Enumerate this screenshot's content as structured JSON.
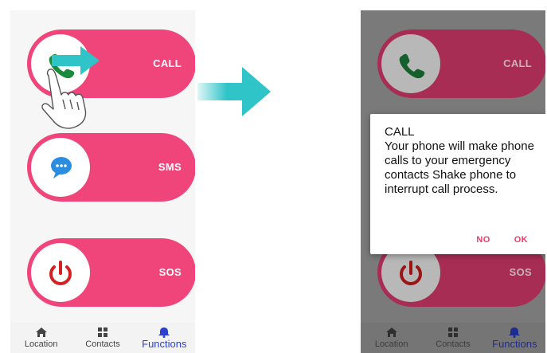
{
  "functions": [
    {
      "id": "call",
      "label": "CALL",
      "icon": "phone-icon"
    },
    {
      "id": "sms",
      "label": "SMS",
      "icon": "chat-bubble-icon"
    },
    {
      "id": "sos",
      "label": "SOS",
      "icon": "power-icon"
    }
  ],
  "nav": [
    {
      "label": "Location",
      "icon": "home-icon"
    },
    {
      "label": "Contacts",
      "icon": "grid-icon"
    },
    {
      "label": "Functions",
      "icon": "bell-icon",
      "active": true
    }
  ],
  "dialog": {
    "title": "CALL",
    "message": "Your phone will make phone calls to your emergency contacts Shake phone to interrupt call process.",
    "no_label": "NO",
    "ok_label": "OK"
  },
  "colors": {
    "pill": "#f0457a",
    "pill_dimmed": "#a82d55",
    "phone_green": "#1a8a3b",
    "sms_blue": "#2a8de0",
    "sos_red": "#d42020",
    "nav_active": "#2b3fd1",
    "dialog_button": "#ee3b6a",
    "arrow": "#2ec4c8"
  }
}
